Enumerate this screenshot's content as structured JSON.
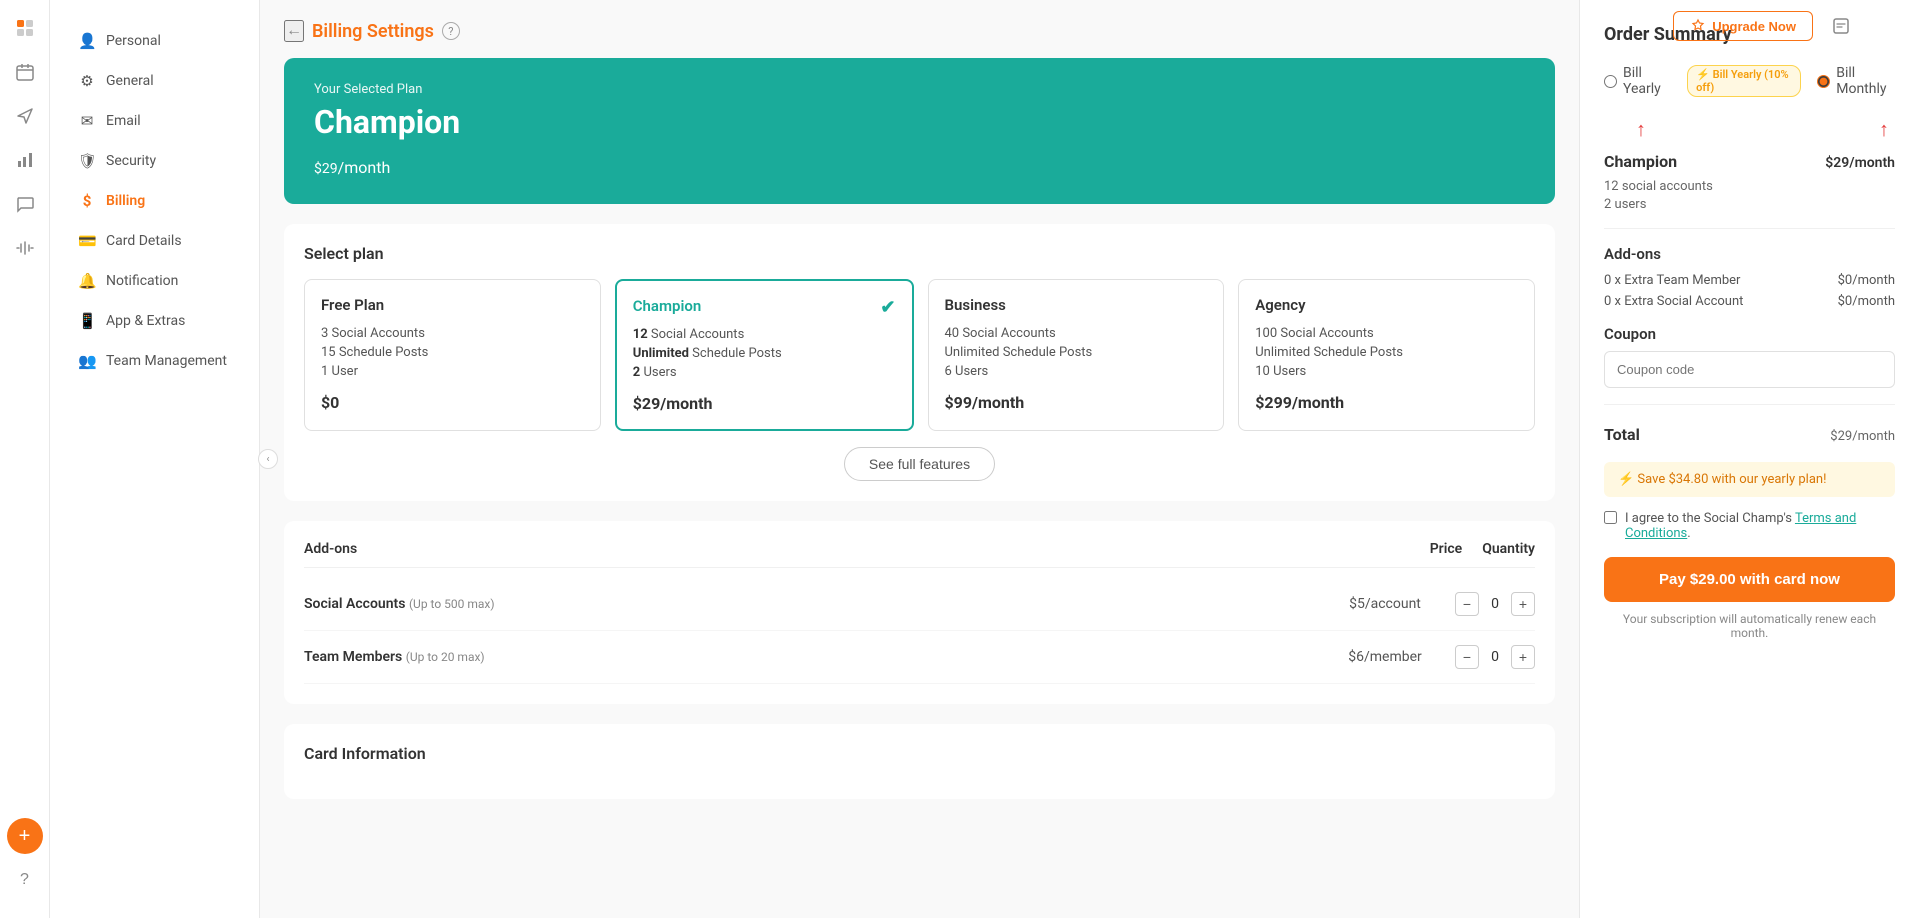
{
  "topbar": {
    "upgrade_label": "Upgrade Now",
    "help_icon": "?"
  },
  "iconbar": {
    "icons": [
      {
        "name": "checkmark-icon",
        "symbol": "✓",
        "active": true
      },
      {
        "name": "calendar-icon",
        "symbol": "▦"
      },
      {
        "name": "send-icon",
        "symbol": "➤"
      },
      {
        "name": "chart-icon",
        "symbol": "▐"
      },
      {
        "name": "comment-icon",
        "symbol": "💬"
      },
      {
        "name": "waveform-icon",
        "symbol": "≋"
      },
      {
        "name": "add-icon",
        "symbol": "+"
      },
      {
        "name": "help-bottom-icon",
        "symbol": "?"
      }
    ]
  },
  "sidebar": {
    "items": [
      {
        "name": "personal",
        "label": "Personal",
        "icon": "👤"
      },
      {
        "name": "general",
        "label": "General",
        "icon": "⚙"
      },
      {
        "name": "email",
        "label": "Email",
        "icon": "✉"
      },
      {
        "name": "security",
        "label": "Security",
        "icon": "🛡"
      },
      {
        "name": "billing",
        "label": "Billing",
        "icon": "$",
        "active": true
      },
      {
        "name": "card-details",
        "label": "Card Details",
        "icon": "💳"
      },
      {
        "name": "notification",
        "label": "Notification",
        "icon": "🔔"
      },
      {
        "name": "app-extras",
        "label": "App & Extras",
        "icon": "📱"
      },
      {
        "name": "team-management",
        "label": "Team Management",
        "icon": "👥"
      }
    ]
  },
  "page": {
    "back_label": "←",
    "title": "Billing Settings",
    "help_text": "?"
  },
  "selected_plan_banner": {
    "label": "Your Selected Plan",
    "plan_name": "Champion",
    "price": "$29",
    "period": "/month"
  },
  "plan_section": {
    "title": "Select plan",
    "plans": [
      {
        "name": "Free Plan",
        "features": [
          "3 Social Accounts",
          "15 Schedule Posts",
          "1 User"
        ],
        "price": "$0",
        "selected": false
      },
      {
        "name": "Champion",
        "features": [
          "12 Social Accounts",
          "Unlimited Schedule Posts",
          "2 Users"
        ],
        "price": "$29/month",
        "selected": true
      },
      {
        "name": "Business",
        "features": [
          "40 Social Accounts",
          "Unlimited Schedule Posts",
          "6 Users"
        ],
        "price": "$99/month",
        "selected": false
      },
      {
        "name": "Agency",
        "features": [
          "100 Social Accounts",
          "Unlimited Schedule Posts",
          "10 Users"
        ],
        "price": "$299/month",
        "selected": false
      }
    ],
    "see_features_label": "See full features"
  },
  "addons": {
    "title": "Add-ons",
    "col_price": "Price",
    "col_qty": "Quantity",
    "items": [
      {
        "name": "Social Accounts",
        "limit": "Up to 500 max",
        "price": "$5/account",
        "qty": 0
      },
      {
        "name": "Team Members",
        "limit": "Up to 20 max",
        "price": "$6/member",
        "qty": 0
      }
    ]
  },
  "card_info": {
    "title": "Card Information"
  },
  "order_summary": {
    "title": "Order Summary",
    "billing": {
      "yearly_label": "Bill Yearly",
      "yearly_badge": "⚡ Bill Yearly (10% off)",
      "monthly_label": "Bill Monthly",
      "selected": "monthly"
    },
    "plan": {
      "name": "Champion",
      "price": "$29/month",
      "detail1": "12 social accounts",
      "detail2": "2 users"
    },
    "addons_title": "Add-ons",
    "addon_lines": [
      {
        "label": "0 x Extra Team Member",
        "price": "$0/month"
      },
      {
        "label": "0 x Extra Social Account",
        "price": "$0/month"
      }
    ],
    "coupon": {
      "label": "Coupon",
      "placeholder": "Coupon code"
    },
    "total": {
      "label": "Total",
      "price": "$29",
      "period": "/month"
    },
    "save_banner": "⚡ Save $34.80 with our yearly plan!",
    "terms_text": "I agree to the Social Champ's ",
    "terms_link": "Terms and Conditions",
    "terms_end": ".",
    "pay_button": "Pay $29.00 with card now",
    "renew_note": "Your subscription will automatically renew each month."
  }
}
